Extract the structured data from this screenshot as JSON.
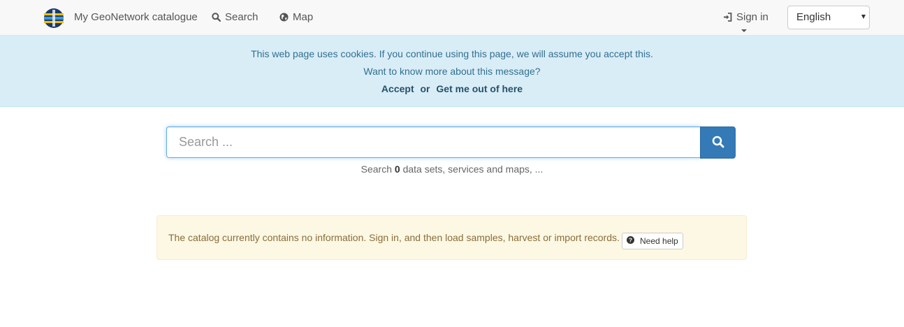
{
  "navbar": {
    "brand": "My GeoNetwork catalogue",
    "search": "Search",
    "map": "Map",
    "signin": "Sign in",
    "language": "English"
  },
  "cookie": {
    "message": "This web page uses cookies. If you continue using this page, we will assume you accept this.",
    "more_link": "Want to know more about this message?",
    "accept": "Accept",
    "or": "or",
    "decline": "Get me out of here"
  },
  "search": {
    "placeholder": "Search ...",
    "count_prefix": "Search",
    "count": "0",
    "count_suffix": "data sets, services and maps, ..."
  },
  "warning": {
    "message": "The catalog currently contains no information. Sign in, and then load samples, harvest or import records.",
    "help_label": "Need help"
  },
  "colors": {
    "primary": "#337ab7",
    "info_bg": "#d9edf7",
    "warning_bg": "#fcf8e3"
  }
}
